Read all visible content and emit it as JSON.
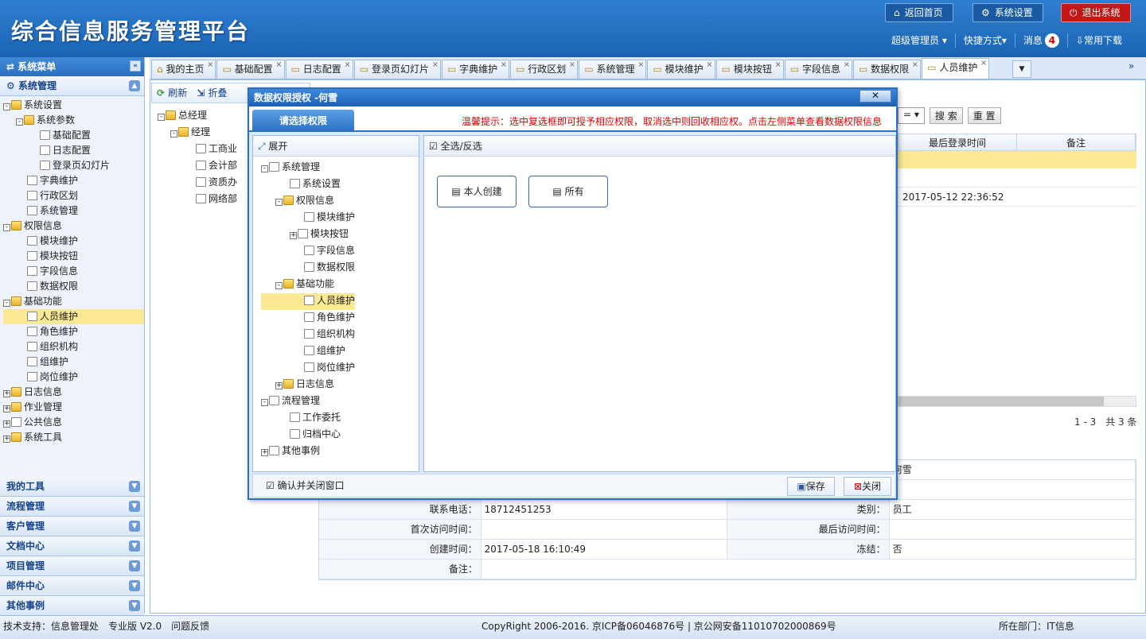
{
  "app": {
    "title": "综合信息服务管理平台",
    "home": "返回首页",
    "settings": "系统设置",
    "exit": "退出系统"
  },
  "userbar": {
    "user": "超级管理员 ▾",
    "shortcut": "快捷方式▾",
    "msg": "消息",
    "msg_count": "4",
    "download": "常用下载"
  },
  "sidebar": {
    "title": "系统菜单",
    "section": "系统管理",
    "items": [
      "系统设置",
      "系统参数",
      "基础配置",
      "日志配置",
      "登录页幻灯片",
      "字典维护",
      "行政区划",
      "系统管理",
      "权限信息",
      "模块维护",
      "模块按钮",
      "字段信息",
      "数据权限",
      "基础功能",
      "人员维护",
      "角色维护",
      "组织机构",
      "组维护",
      "岗位维护",
      "日志信息",
      "作业管理",
      "公共信息",
      "系统工具"
    ],
    "acc": [
      "我的工具",
      "流程管理",
      "客户管理",
      "文档中心",
      "项目管理",
      "邮件中心",
      "其他事例"
    ]
  },
  "tabs": [
    "我的主页",
    "基础配置",
    "日志配置",
    "登录页幻灯片",
    "字典维护",
    "行政区划",
    "系统管理",
    "模块维护",
    "模块按钮",
    "字段信息",
    "数据权限",
    "人员维护"
  ],
  "subtool": {
    "refresh": "刷新",
    "fold": "折叠"
  },
  "orgtree": [
    "总经理",
    "经理",
    "工商业",
    "会计部",
    "资质办",
    "网络部"
  ],
  "search": {
    "eq": "= ▾",
    "search": "搜 索",
    "reset": "重 置"
  },
  "grid": {
    "headers": [
      "最后登录时间",
      "备注"
    ],
    "cell": "2017-05-12 22:36:52",
    "pager": "1 - 3　共 3 条"
  },
  "detail": {
    "phone_label": "联系电话：",
    "phone": "18712451253",
    "type_label": "类别：",
    "type": "员工",
    "first_label": "首次访问时间：",
    "last_label": "最后访问时间：",
    "create_label": "创建时间：",
    "create": "2017-05-18 16:10:49",
    "freeze_label": "冻结：",
    "freeze": "否",
    "note_label": "备注：",
    "name_tail": "何雪"
  },
  "dialog": {
    "title": "数据权限授权 -何雪",
    "tab": "请选择权限",
    "tip": "温馨提示：选中复选框即可授予相应权限，取消选中则回收相应权。点击左侧菜单查看数据权限信息",
    "expand": "展开",
    "selectall": "全选/反选",
    "tree": [
      "系统管理",
      "系统设置",
      "权限信息",
      "模块维护",
      "模块按钮",
      "字段信息",
      "数据权限",
      "基础功能",
      "人员维护",
      "角色维护",
      "组织机构",
      "组维护",
      "岗位维护",
      "日志信息",
      "流程管理",
      "工作委托",
      "归档中心",
      "其他事例"
    ],
    "perm1": "本人创建",
    "perm2": "所有",
    "confirm": "确认并关闭窗口",
    "save": "保存",
    "close": "关闭"
  },
  "footer": {
    "left": "技术支持：信息管理处　专业版 V2.0　问题反馈",
    "center": "CopyRight 2006-2016. 京ICP备06046876号 | 京公网安备11010702000869号",
    "right": "所在部门：IT信息"
  }
}
